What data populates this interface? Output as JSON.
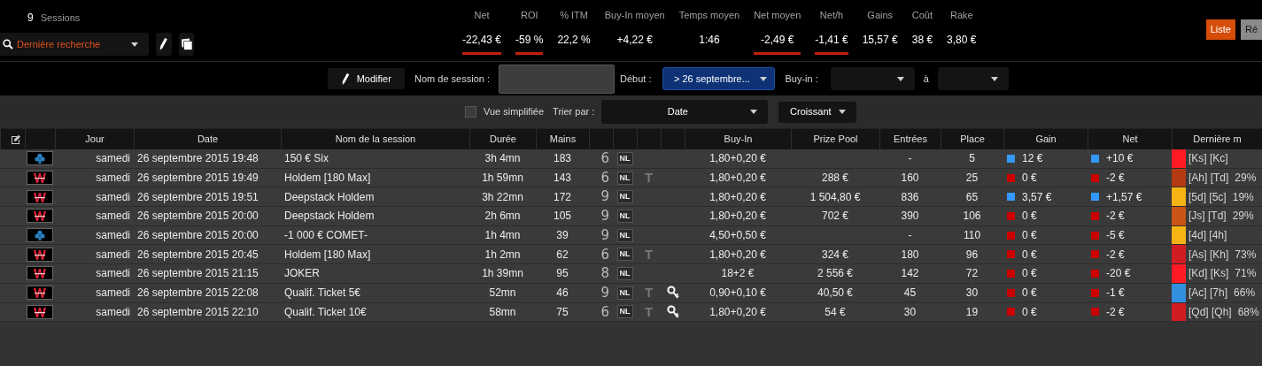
{
  "summary": {
    "count": "9",
    "label": "Sessions"
  },
  "search": {
    "value": "Dernière recherche"
  },
  "stats": [
    {
      "label": "Net",
      "value": "-22,43 €",
      "negative": true
    },
    {
      "label": "ROI",
      "value": "-59 %",
      "negative": true
    },
    {
      "label": "% ITM",
      "value": "22,2 %",
      "negative": false
    },
    {
      "label": "Buy-In moyen",
      "value": "+4,22 €",
      "negative": false
    },
    {
      "label": "Temps moyen",
      "value": "1:46",
      "negative": false
    },
    {
      "label": "Net moyen",
      "value": "-2,49 €",
      "negative": true
    },
    {
      "label": "Net/h",
      "value": "-1,41 €",
      "negative": true
    },
    {
      "label": "Gains",
      "value": "15,57 €",
      "negative": false
    },
    {
      "label": "Coût",
      "value": "38 €",
      "negative": false
    },
    {
      "label": "Rake",
      "value": "3,80 €",
      "negative": false
    }
  ],
  "view_buttons": [
    {
      "label": "Liste",
      "selected": true
    },
    {
      "label": "Ré",
      "selected": false
    }
  ],
  "filters": {
    "edit_button": "Modifier",
    "session_name_label": "Nom de session :",
    "start_label": "Début :",
    "start_value": "> 26 septembre...",
    "buyin_label": "Buy-in :",
    "to_label": "à"
  },
  "sort_bar": {
    "simplified": {
      "label": "Vue simplifiée",
      "checked": false
    },
    "sort_label": "Trier par :",
    "sort_value": "Date",
    "order_value": "Croissant"
  },
  "table": {
    "columns": [
      {
        "kind": "edit"
      },
      {
        "kind": "blank"
      },
      {
        "kind": "text",
        "label": "Jour"
      },
      {
        "kind": "text",
        "label": "Date"
      },
      {
        "kind": "text",
        "label": "Nom de la session"
      },
      {
        "kind": "text",
        "label": "Durée"
      },
      {
        "kind": "text",
        "label": "Mains"
      },
      {
        "kind": "blank"
      },
      {
        "kind": "blank"
      },
      {
        "kind": "blank"
      },
      {
        "kind": "blank"
      },
      {
        "kind": "text",
        "label": "Buy-In"
      },
      {
        "kind": "text",
        "label": "Prize Pool"
      },
      {
        "kind": "text",
        "label": "Entrées"
      },
      {
        "kind": "text",
        "label": "Place"
      },
      {
        "kind": "text",
        "label": "Gain"
      },
      {
        "kind": "text",
        "label": "Net"
      },
      {
        "kind": "text",
        "label": "Dernière m"
      }
    ],
    "rows": [
      {
        "kind": "club",
        "day": "samedi",
        "date": "26 septembre 2015 19:48",
        "name": "150 € Six",
        "duration": "3h 4mn",
        "hands": "183",
        "seats": "6",
        "limit": "NL",
        "key": false,
        "buyin": "1,80+0,20 €",
        "entries": "-",
        "place": "5",
        "gain": {
          "text": "12 €",
          "color": "#3399ff"
        },
        "net": {
          "text": "+10 €",
          "color": "#3399ff"
        },
        "last_hand": {
          "color": "#ff1a26",
          "cards": "[Ks] [Kc]"
        }
      },
      {
        "kind": "w",
        "day": "samedi",
        "date": "26 septembre 2015 19:49",
        "name": "Holdem [180 Max]",
        "duration": "1h 59mn",
        "hands": "143",
        "seats": "6",
        "limit": "NL",
        "ticket": "T",
        "key": false,
        "buyin": "1,80+0,20 €",
        "prize_pool": "288 €",
        "entries": "160",
        "place": "25",
        "gain": {
          "text": "0 €",
          "color": "#cc0000"
        },
        "net": {
          "text": "-2 €",
          "color": "#cc0000"
        },
        "last_hand": {
          "color": "#b33a12",
          "cards": "[Ah] [Td]",
          "pct": "29%"
        }
      },
      {
        "kind": "w",
        "day": "samedi",
        "date": "26 septembre 2015 19:51",
        "name": "Deepstack Holdem",
        "duration": "3h 22mn",
        "hands": "172",
        "seats": "9",
        "limit": "NL",
        "key": false,
        "buyin": "1,80+0,20 €",
        "prize_pool": "1 504,80 €",
        "entries": "836",
        "place": "65",
        "gain": {
          "text": "3,57 €",
          "color": "#3399ff"
        },
        "net": {
          "text": "+1,57 €",
          "color": "#3399ff"
        },
        "last_hand": {
          "color": "#f5b414",
          "cards": "[5d] [5c]",
          "pct": "19%"
        }
      },
      {
        "kind": "w",
        "day": "samedi",
        "date": "26 septembre 2015 20:00",
        "name": "Deepstack Holdem",
        "duration": "2h 6mn",
        "hands": "105",
        "seats": "9",
        "limit": "NL",
        "key": false,
        "buyin": "1,80+0,20 €",
        "prize_pool": "702 €",
        "entries": "390",
        "place": "106",
        "gain": {
          "text": "0 €",
          "color": "#cc0000"
        },
        "net": {
          "text": "-2 €",
          "color": "#cc0000"
        },
        "last_hand": {
          "color": "#c85514",
          "cards": "[Js] [Td]",
          "pct": "29%"
        }
      },
      {
        "kind": "club",
        "day": "samedi",
        "date": "26 septembre 2015 20:00",
        "name": "-1 000 € COMET-",
        "duration": "1h 4mn",
        "hands": "39",
        "seats": "9",
        "limit": "NL",
        "key": false,
        "buyin": "4,50+0,50 €",
        "entries": "-",
        "place": "110",
        "gain": {
          "text": "0 €",
          "color": "#cc0000"
        },
        "net": {
          "text": "-5 €",
          "color": "#cc0000"
        },
        "last_hand": {
          "color": "#f5b414",
          "cards": "[4d] [4h]"
        }
      },
      {
        "kind": "w",
        "day": "samedi",
        "date": "26 septembre 2015 20:45",
        "name": "Holdem [180 Max]",
        "duration": "1h 2mn",
        "hands": "62",
        "seats": "6",
        "limit": "NL",
        "ticket": "T",
        "key": false,
        "buyin": "1,80+0,20 €",
        "prize_pool": "324 €",
        "entries": "180",
        "place": "96",
        "gain": {
          "text": "0 €",
          "color": "#cc0000"
        },
        "net": {
          "text": "-2 €",
          "color": "#cc0000"
        },
        "last_hand": {
          "color": "#d21c24",
          "cards": "[As] [Kh]",
          "pct": "73%"
        }
      },
      {
        "kind": "w",
        "day": "samedi",
        "date": "26 septembre 2015 21:15",
        "name": "JOKER",
        "duration": "1h 39mn",
        "hands": "95",
        "seats": "8",
        "limit": "NL",
        "key": false,
        "buyin": "18+2 €",
        "prize_pool": "2 556 €",
        "entries": "142",
        "place": "72",
        "gain": {
          "text": "0 €",
          "color": "#cc0000"
        },
        "net": {
          "text": "-20 €",
          "color": "#cc0000"
        },
        "last_hand": {
          "color": "#ff1a26",
          "cards": "[Kd] [Ks]",
          "pct": "71%"
        }
      },
      {
        "kind": "w",
        "day": "samedi",
        "date": "26 septembre 2015 22:08",
        "name": "Qualif. Ticket 5€",
        "duration": "52mn",
        "hands": "46",
        "seats": "9",
        "limit": "NL",
        "ticket": "T",
        "key": true,
        "buyin": "0,90+0,10 €",
        "prize_pool": "40,50 €",
        "entries": "45",
        "place": "30",
        "gain": {
          "text": "0 €",
          "color": "#cc0000"
        },
        "net": {
          "text": "-1 €",
          "color": "#cc0000"
        },
        "last_hand": {
          "color": "#3390e0",
          "cards": "[Ac] [7h]",
          "pct": "66%"
        }
      },
      {
        "kind": "w",
        "day": "samedi",
        "date": "26 septembre 2015 22:10",
        "name": "Qualif. Ticket 10€",
        "duration": "58mn",
        "hands": "75",
        "seats": "6",
        "limit": "NL",
        "ticket": "T",
        "key": true,
        "buyin": "1,80+0,20 €",
        "prize_pool": "54 €",
        "entries": "30",
        "place": "19",
        "gain": {
          "text": "0 €",
          "color": "#cc0000"
        },
        "net": {
          "text": "-2 €",
          "color": "#cc0000"
        },
        "last_hand": {
          "color": "#d21c24",
          "cards": "[Qd] [Qh]",
          "pct": "68%"
        }
      }
    ]
  }
}
